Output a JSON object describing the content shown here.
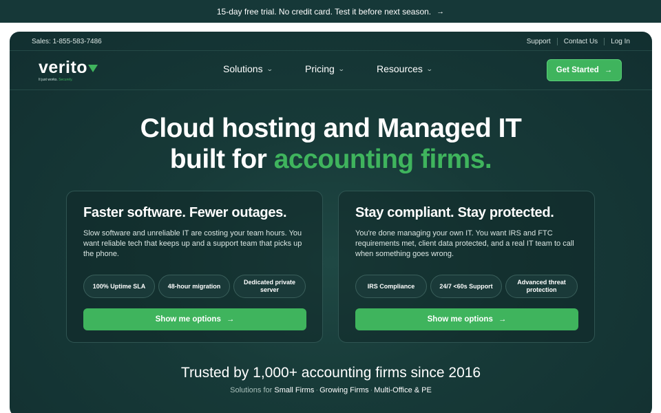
{
  "promo": {
    "text": "15-day free trial. No credit card. Test it before next season.",
    "arrow": "→"
  },
  "utility": {
    "sales": "Sales: 1-855-583-7486",
    "links": [
      "Support",
      "Contact Us",
      "Log In"
    ]
  },
  "logo": {
    "word": "verito",
    "tagline_a": "It just works.",
    "tagline_b": "Securely."
  },
  "nav": {
    "items": [
      "Solutions",
      "Pricing",
      "Resources"
    ],
    "chevron": "⌄",
    "cta": "Get Started",
    "cta_arrow": "→"
  },
  "hero": {
    "line1": "Cloud hosting and Managed IT",
    "line2_pre": "built for ",
    "line2_accent": "accounting firms."
  },
  "cards": [
    {
      "title": "Faster software. Fewer outages.",
      "body": "Slow software and unreliable IT are costing your team hours. You want reliable tech that keeps up and a support team that picks up the phone.",
      "chips": [
        "100% Uptime SLA",
        "48-hour migration",
        "Dedicated private server"
      ],
      "button": "Show me options",
      "arrow": "→"
    },
    {
      "title": "Stay compliant. Stay protected.",
      "body": "You're done managing your own IT. You want IRS and FTC requirements met, client data protected, and a real IT team to call when something goes wrong.",
      "chips": [
        "IRS Compliance",
        "24/7 <60s Support",
        "Advanced threat protection"
      ],
      "button": "Show me options",
      "arrow": "→"
    }
  ],
  "trusted": {
    "heading": "Trusted by 1,000+ accounting firms since 2016",
    "prefix": "Solutions for",
    "links": [
      "Small Firms",
      "Growing Firms",
      "Multi-Office & PE"
    ],
    "separator": "·"
  },
  "colors": {
    "accent": "#3fb45d",
    "background": "#173a38",
    "promo_bar": "#163838"
  }
}
